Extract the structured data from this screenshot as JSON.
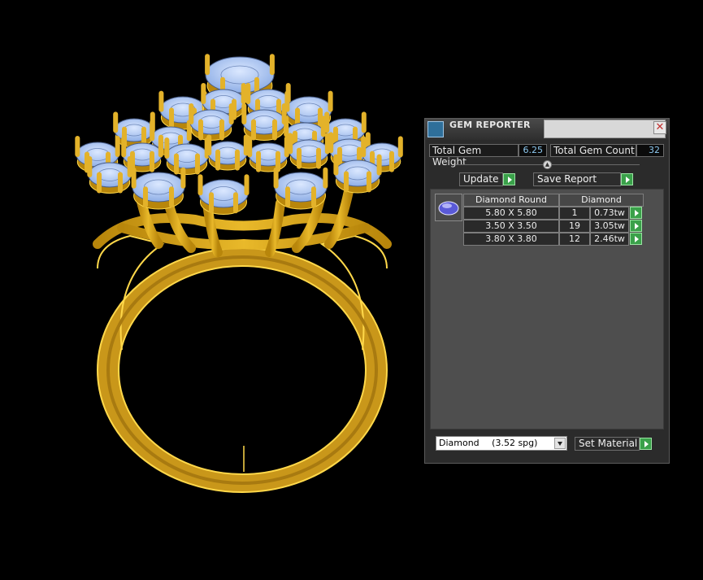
{
  "panel": {
    "title": "GEM REPORTER",
    "total_gem_weight_label": "Total Gem Weight",
    "total_gem_weight_value": "6.25",
    "total_gem_count_label": "Total Gem Count",
    "total_gem_count_value": "32",
    "update_label": "Update",
    "save_report_label": "Save Report",
    "table": {
      "header": [
        "Diamond Round",
        "Diamond"
      ],
      "rows": [
        {
          "size": "5.80 X 5.80",
          "count": "1",
          "weight": "0.73tw"
        },
        {
          "size": "3.50 X 3.50",
          "count": "19",
          "weight": "3.05tw"
        },
        {
          "size": "3.80 X 3.80",
          "count": "12",
          "weight": "2.46tw"
        }
      ]
    },
    "material_select": {
      "name": "Diamond",
      "density": "(3.52 spg)"
    },
    "set_material_label": "Set Material"
  },
  "colors": {
    "metal": "#d8a81f",
    "metal_edge": "#ffd84a",
    "gem": "#a8c4f2",
    "accent_green": "#3aa14a",
    "value_text": "#8cc7ee"
  },
  "icons": [
    "app-icon",
    "close-icon",
    "play-icon",
    "gem-thumbnail-icon",
    "chevron-down-icon",
    "collapse-arrow-icon"
  ]
}
